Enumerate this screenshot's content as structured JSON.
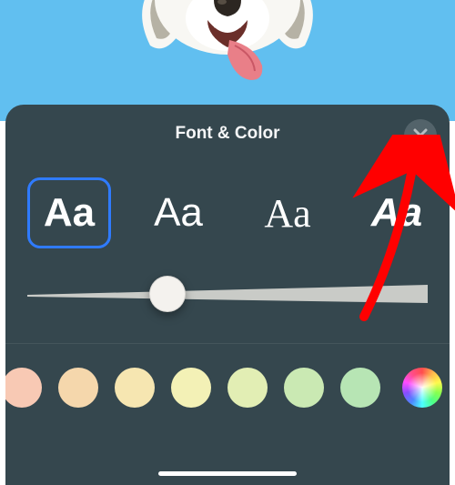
{
  "header": {
    "title": "Font & Color"
  },
  "fonts": {
    "items": [
      {
        "sample": "Aa",
        "style": "sans",
        "selected": true
      },
      {
        "sample": "Aa",
        "style": "sans2",
        "selected": false
      },
      {
        "sample": "Aa",
        "style": "serif",
        "selected": false
      },
      {
        "sample": "Aa",
        "style": "bold",
        "selected": false
      }
    ]
  },
  "slider": {
    "min": 0,
    "max": 100,
    "value": 35
  },
  "colors": {
    "swatches": [
      "#f8c9b4",
      "#f5d7ac",
      "#f6e6b1",
      "#f3f1b6",
      "#e2eeb4",
      "#cae9b3",
      "#b7e5b4"
    ]
  }
}
